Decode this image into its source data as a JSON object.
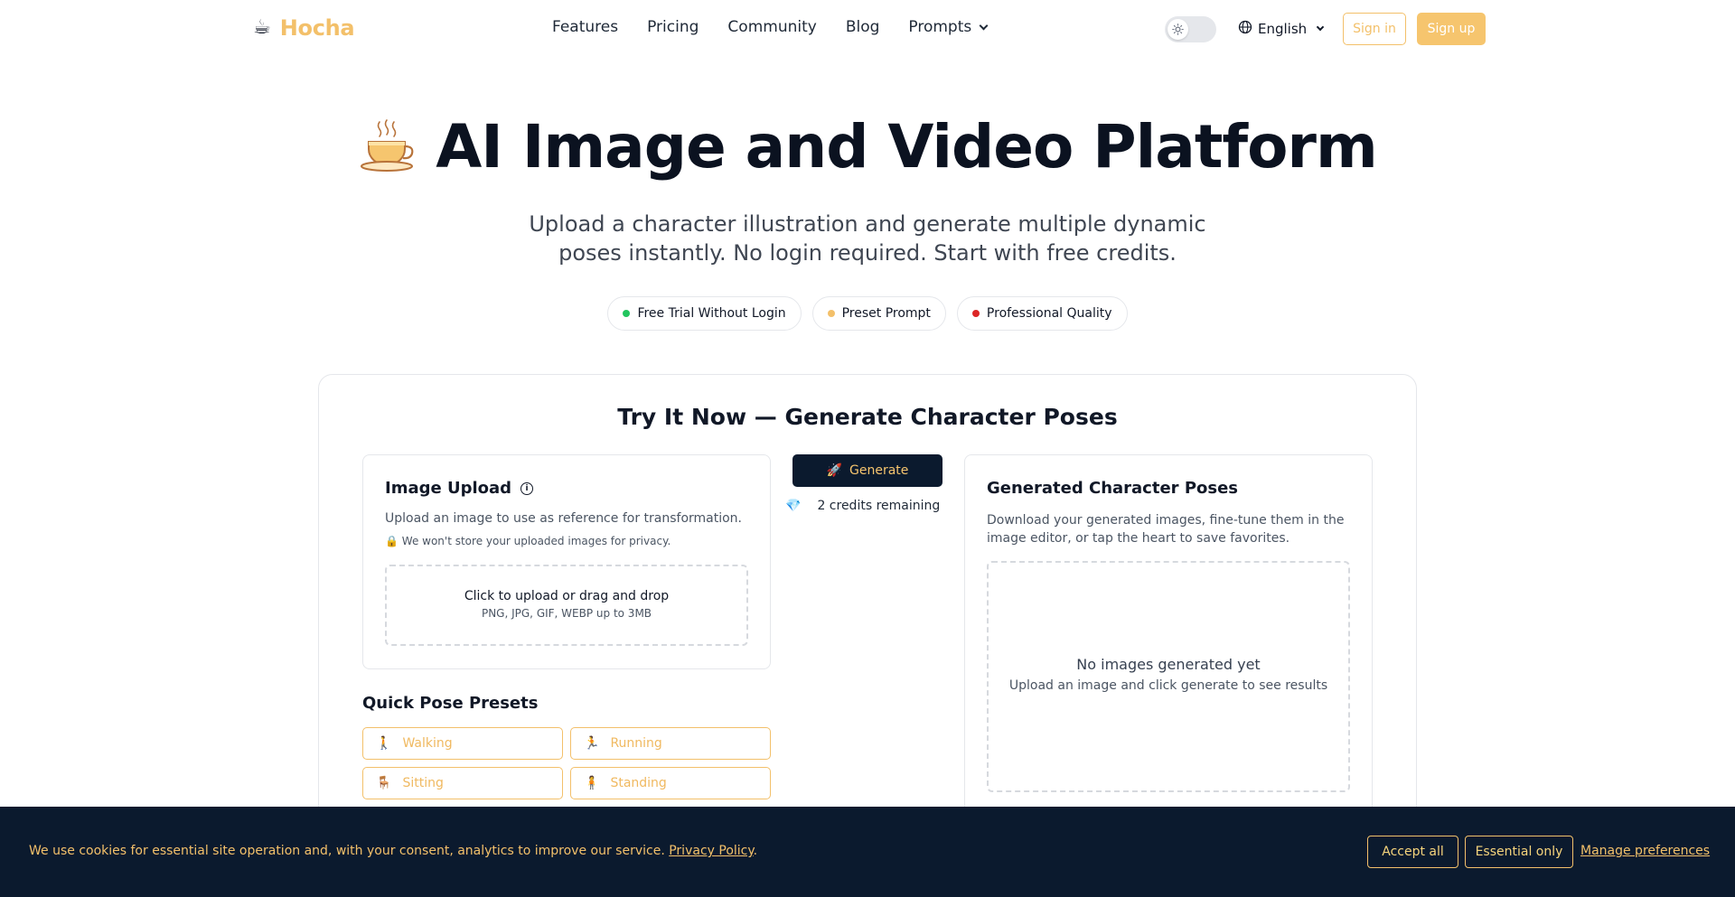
{
  "nav": {
    "logo_text": "Hocha",
    "links": [
      "Features",
      "Pricing",
      "Community",
      "Blog"
    ],
    "prompts_label": "Prompts",
    "language": "English",
    "signin_label": "Sign in",
    "signup_label": "Sign up"
  },
  "hero": {
    "title": "AI Image and Video Platform",
    "subtitle": "Upload a character illustration and generate multiple dynamic poses instantly. No login required. Start with free credits.",
    "pills": [
      {
        "label": "Free Trial Without Login",
        "color": "#22c55e"
      },
      {
        "label": "Preset Prompt",
        "color": "#f3c06a"
      },
      {
        "label": "Professional Quality",
        "color": "#dc2626"
      }
    ]
  },
  "tool": {
    "title": "Try It Now — Generate Character Poses",
    "upload": {
      "heading": "Image Upload",
      "description": "Upload an image to use as reference for transformation.",
      "privacy": "We won't store your uploaded images for privacy.",
      "dropzone_main": "Click to upload or drag and drop",
      "dropzone_sub": "PNG, JPG, GIF, WEBP up to 3MB"
    },
    "presets": {
      "heading": "Quick Pose Presets",
      "items": [
        {
          "label": "Walking",
          "icon": "🚶"
        },
        {
          "label": "Running",
          "icon": "🏃"
        },
        {
          "label": "Sitting",
          "icon": "🪑"
        },
        {
          "label": "Standing",
          "icon": "🧍"
        }
      ]
    },
    "generate_label": "Generate",
    "credits_text": "2 credits remaining",
    "results": {
      "heading": "Generated Character Poses",
      "description": "Download your generated images, fine-tune them in the image editor, or tap the heart to save favorites.",
      "empty_main": "No images generated yet",
      "empty_sub": "Upload an image and click generate to see results"
    }
  },
  "cookie": {
    "text": "We use cookies for essential site operation and, with your consent, analytics to improve our service.",
    "policy_link": "Privacy Policy",
    "accept_label": "Accept all",
    "essential_label": "Essential only",
    "manage_label": "Manage preferences"
  }
}
